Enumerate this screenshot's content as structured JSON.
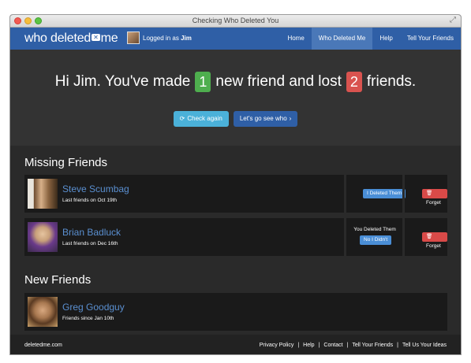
{
  "window": {
    "title": "Checking Who Deleted You"
  },
  "nav": {
    "brand_left": "who deleted",
    "brand_mark": "✕",
    "brand_right": "me",
    "logged_prefix": "Logged in as",
    "user": "Jim",
    "links": [
      "Home",
      "Who Deleted Me",
      "Help",
      "Tell Your Friends"
    ],
    "active_index": 1
  },
  "hero": {
    "part1": "Hi Jim. You've made",
    "new_count": "1",
    "part2": "new friend and lost",
    "lost_count": "2",
    "part3": "friends.",
    "check_button": "Check again",
    "go_button": "Let's go see who"
  },
  "missing": {
    "title": "Missing Friends",
    "friends": [
      {
        "name": "Steve Scumbag",
        "since": "Last friends on Oct 19th",
        "deleted_label": "I Deleted Them",
        "forget_label": "Forget"
      },
      {
        "name": "Brian Badluck",
        "since": "Last friends on Dec 16th",
        "status_text": "You Deleted Them",
        "undo_label": "No I Didn't",
        "forget_label": "Forget"
      }
    ]
  },
  "newfriends": {
    "title": "New Friends",
    "friends": [
      {
        "name": "Greg Goodguy",
        "since": "Friends since Jan 10th"
      }
    ]
  },
  "footer": {
    "site": "deletedme.com",
    "links": [
      "Privacy Policy",
      "Help",
      "Contact",
      "Tell Your Friends",
      "Tell Us Your Ideas"
    ],
    "separator": "|"
  },
  "colors": {
    "navbar": "#2f5fa6",
    "green": "#4eae4e",
    "red": "#d9534f",
    "link": "#5a8fd0"
  }
}
